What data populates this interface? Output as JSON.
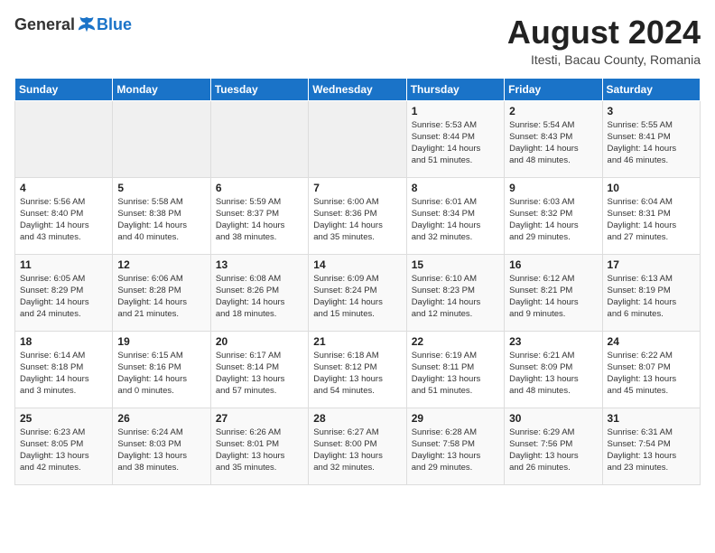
{
  "header": {
    "logo_general": "General",
    "logo_blue": "Blue",
    "month_year": "August 2024",
    "location": "Itesti, Bacau County, Romania"
  },
  "days_of_week": [
    "Sunday",
    "Monday",
    "Tuesday",
    "Wednesday",
    "Thursday",
    "Friday",
    "Saturday"
  ],
  "weeks": [
    [
      {
        "num": "",
        "detail": ""
      },
      {
        "num": "",
        "detail": ""
      },
      {
        "num": "",
        "detail": ""
      },
      {
        "num": "",
        "detail": ""
      },
      {
        "num": "1",
        "detail": "Sunrise: 5:53 AM\nSunset: 8:44 PM\nDaylight: 14 hours\nand 51 minutes."
      },
      {
        "num": "2",
        "detail": "Sunrise: 5:54 AM\nSunset: 8:43 PM\nDaylight: 14 hours\nand 48 minutes."
      },
      {
        "num": "3",
        "detail": "Sunrise: 5:55 AM\nSunset: 8:41 PM\nDaylight: 14 hours\nand 46 minutes."
      }
    ],
    [
      {
        "num": "4",
        "detail": "Sunrise: 5:56 AM\nSunset: 8:40 PM\nDaylight: 14 hours\nand 43 minutes."
      },
      {
        "num": "5",
        "detail": "Sunrise: 5:58 AM\nSunset: 8:38 PM\nDaylight: 14 hours\nand 40 minutes."
      },
      {
        "num": "6",
        "detail": "Sunrise: 5:59 AM\nSunset: 8:37 PM\nDaylight: 14 hours\nand 38 minutes."
      },
      {
        "num": "7",
        "detail": "Sunrise: 6:00 AM\nSunset: 8:36 PM\nDaylight: 14 hours\nand 35 minutes."
      },
      {
        "num": "8",
        "detail": "Sunrise: 6:01 AM\nSunset: 8:34 PM\nDaylight: 14 hours\nand 32 minutes."
      },
      {
        "num": "9",
        "detail": "Sunrise: 6:03 AM\nSunset: 8:32 PM\nDaylight: 14 hours\nand 29 minutes."
      },
      {
        "num": "10",
        "detail": "Sunrise: 6:04 AM\nSunset: 8:31 PM\nDaylight: 14 hours\nand 27 minutes."
      }
    ],
    [
      {
        "num": "11",
        "detail": "Sunrise: 6:05 AM\nSunset: 8:29 PM\nDaylight: 14 hours\nand 24 minutes."
      },
      {
        "num": "12",
        "detail": "Sunrise: 6:06 AM\nSunset: 8:28 PM\nDaylight: 14 hours\nand 21 minutes."
      },
      {
        "num": "13",
        "detail": "Sunrise: 6:08 AM\nSunset: 8:26 PM\nDaylight: 14 hours\nand 18 minutes."
      },
      {
        "num": "14",
        "detail": "Sunrise: 6:09 AM\nSunset: 8:24 PM\nDaylight: 14 hours\nand 15 minutes."
      },
      {
        "num": "15",
        "detail": "Sunrise: 6:10 AM\nSunset: 8:23 PM\nDaylight: 14 hours\nand 12 minutes."
      },
      {
        "num": "16",
        "detail": "Sunrise: 6:12 AM\nSunset: 8:21 PM\nDaylight: 14 hours\nand 9 minutes."
      },
      {
        "num": "17",
        "detail": "Sunrise: 6:13 AM\nSunset: 8:19 PM\nDaylight: 14 hours\nand 6 minutes."
      }
    ],
    [
      {
        "num": "18",
        "detail": "Sunrise: 6:14 AM\nSunset: 8:18 PM\nDaylight: 14 hours\nand 3 minutes."
      },
      {
        "num": "19",
        "detail": "Sunrise: 6:15 AM\nSunset: 8:16 PM\nDaylight: 14 hours\nand 0 minutes."
      },
      {
        "num": "20",
        "detail": "Sunrise: 6:17 AM\nSunset: 8:14 PM\nDaylight: 13 hours\nand 57 minutes."
      },
      {
        "num": "21",
        "detail": "Sunrise: 6:18 AM\nSunset: 8:12 PM\nDaylight: 13 hours\nand 54 minutes."
      },
      {
        "num": "22",
        "detail": "Sunrise: 6:19 AM\nSunset: 8:11 PM\nDaylight: 13 hours\nand 51 minutes."
      },
      {
        "num": "23",
        "detail": "Sunrise: 6:21 AM\nSunset: 8:09 PM\nDaylight: 13 hours\nand 48 minutes."
      },
      {
        "num": "24",
        "detail": "Sunrise: 6:22 AM\nSunset: 8:07 PM\nDaylight: 13 hours\nand 45 minutes."
      }
    ],
    [
      {
        "num": "25",
        "detail": "Sunrise: 6:23 AM\nSunset: 8:05 PM\nDaylight: 13 hours\nand 42 minutes."
      },
      {
        "num": "26",
        "detail": "Sunrise: 6:24 AM\nSunset: 8:03 PM\nDaylight: 13 hours\nand 38 minutes."
      },
      {
        "num": "27",
        "detail": "Sunrise: 6:26 AM\nSunset: 8:01 PM\nDaylight: 13 hours\nand 35 minutes."
      },
      {
        "num": "28",
        "detail": "Sunrise: 6:27 AM\nSunset: 8:00 PM\nDaylight: 13 hours\nand 32 minutes."
      },
      {
        "num": "29",
        "detail": "Sunrise: 6:28 AM\nSunset: 7:58 PM\nDaylight: 13 hours\nand 29 minutes."
      },
      {
        "num": "30",
        "detail": "Sunrise: 6:29 AM\nSunset: 7:56 PM\nDaylight: 13 hours\nand 26 minutes."
      },
      {
        "num": "31",
        "detail": "Sunrise: 6:31 AM\nSunset: 7:54 PM\nDaylight: 13 hours\nand 23 minutes."
      }
    ]
  ]
}
